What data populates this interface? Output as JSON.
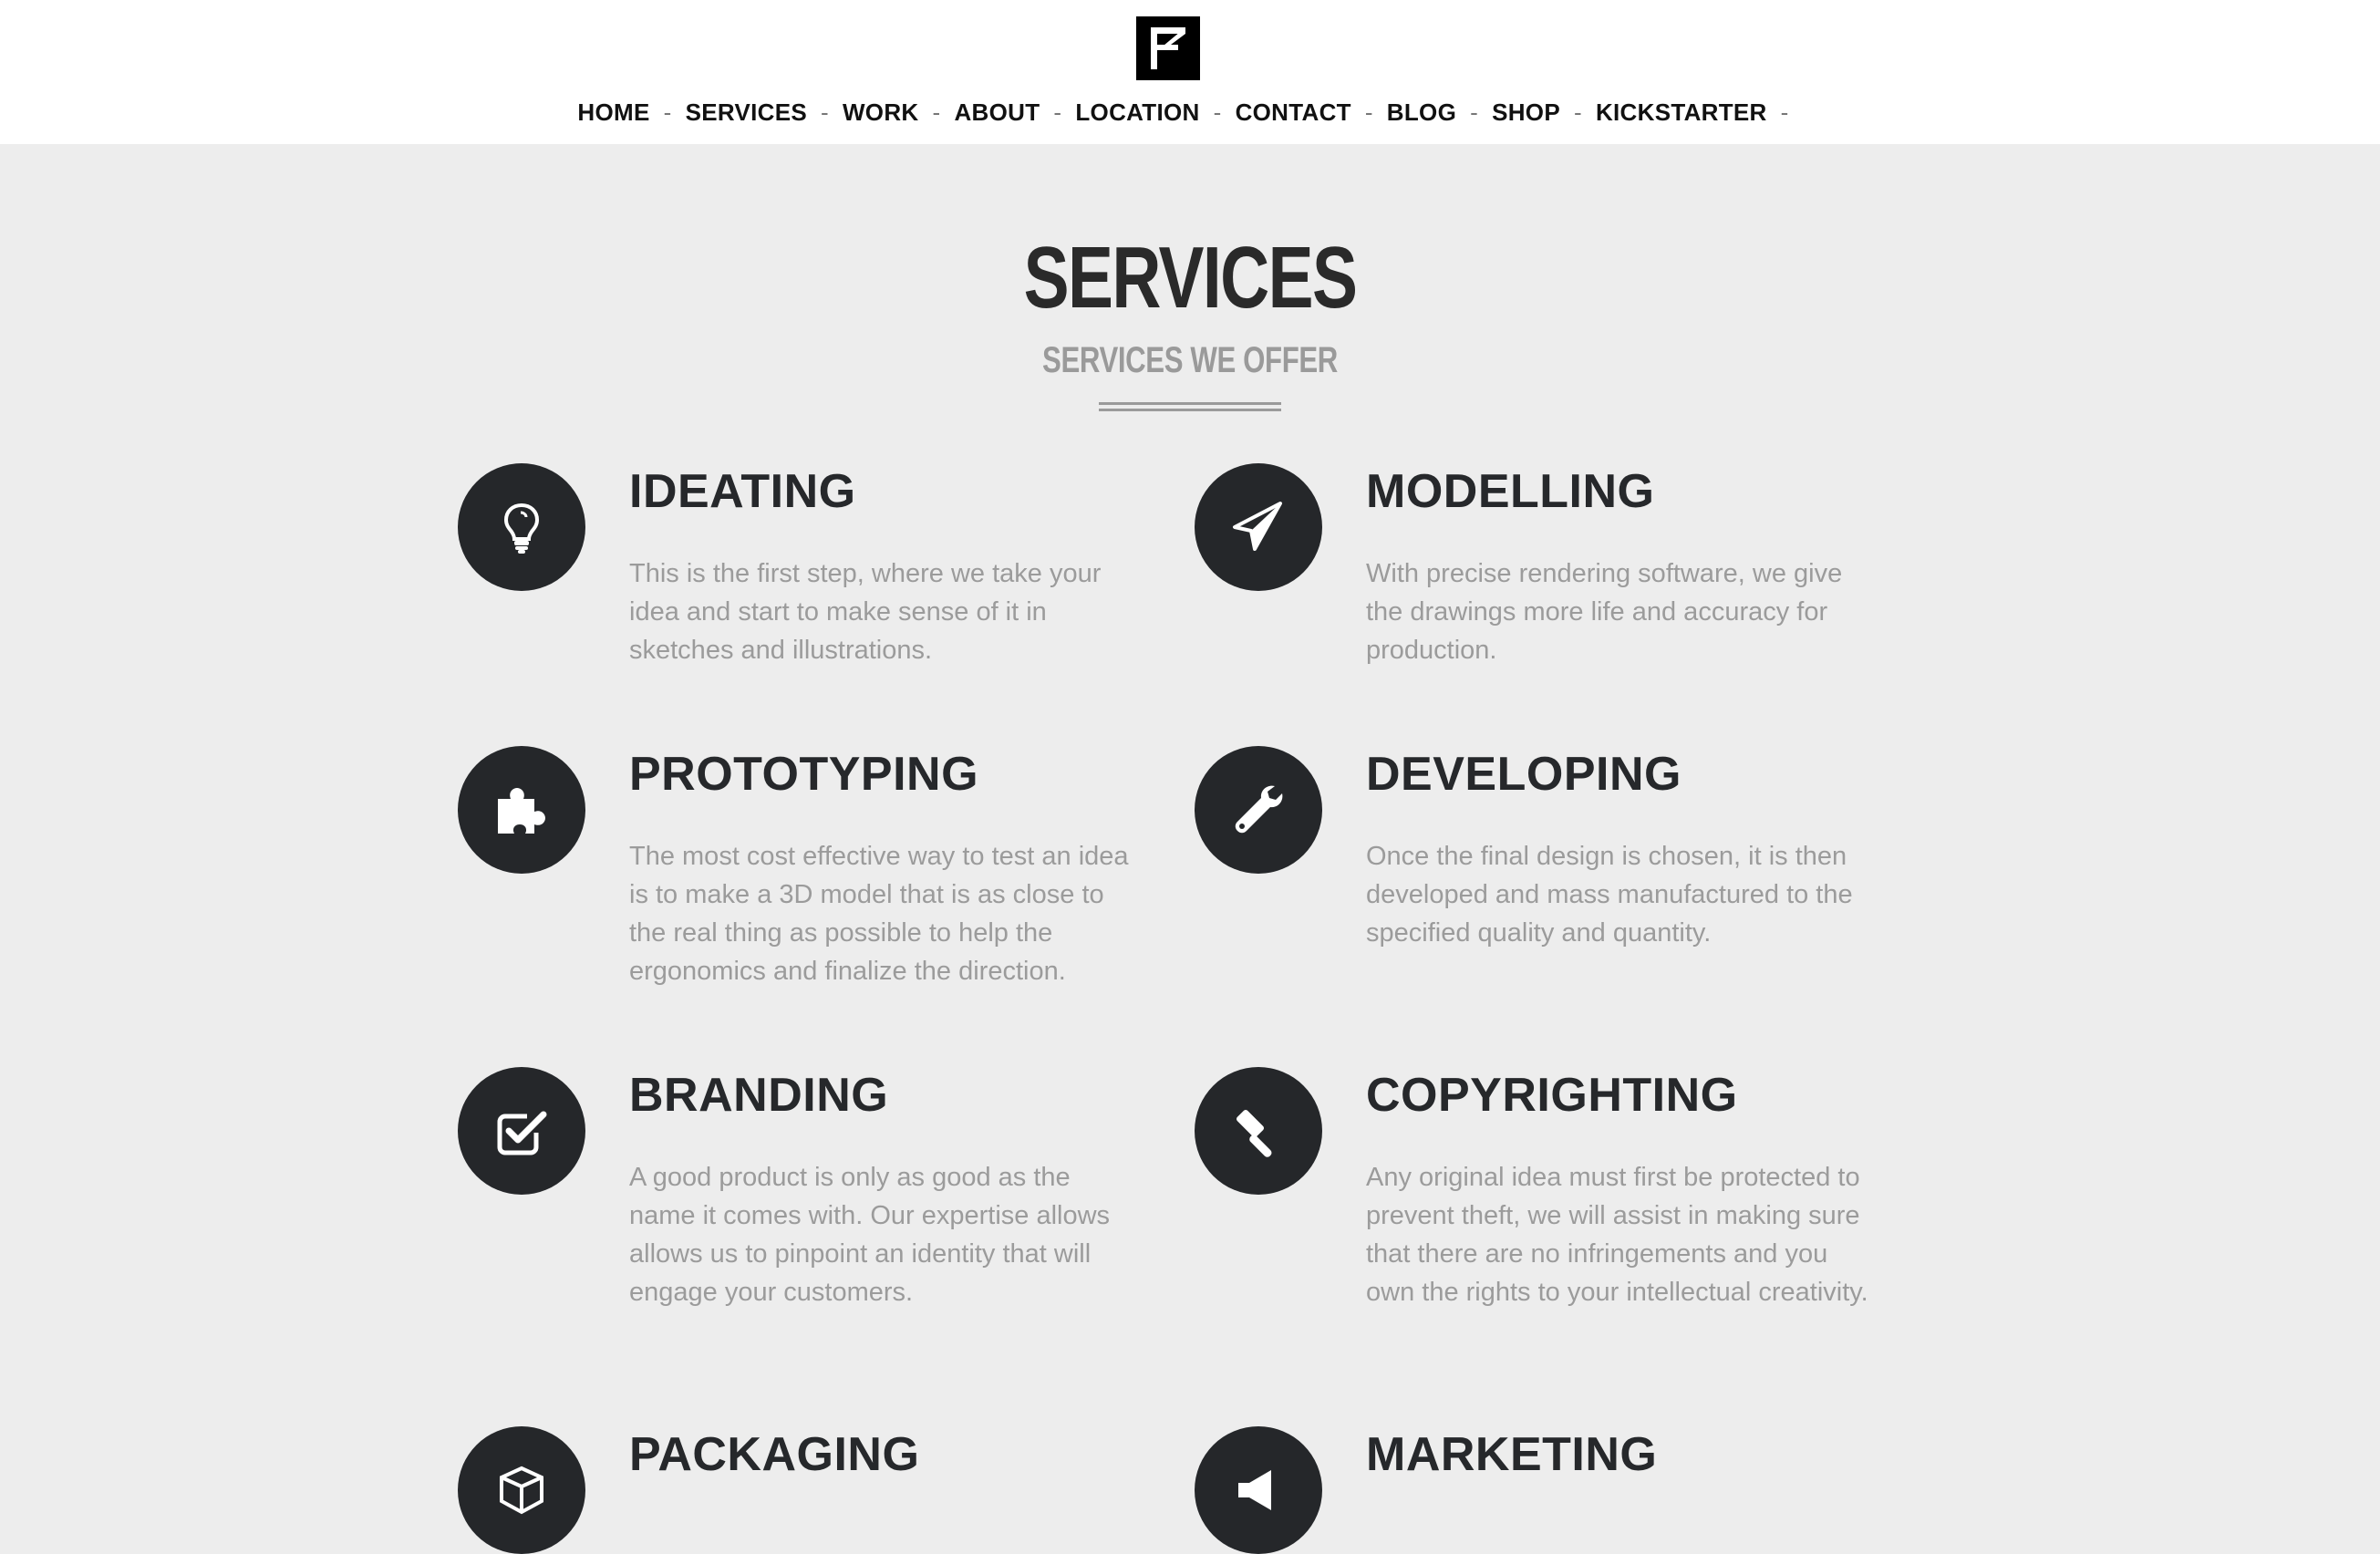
{
  "nav": {
    "items": [
      "HOME",
      "SERVICES",
      "WORK",
      "ABOUT",
      "LOCATION",
      "CONTACT",
      "BLOG",
      "SHOP",
      "KICKSTARTER"
    ],
    "separator": "-"
  },
  "header": {
    "title": "SERVICES",
    "subtitle": "SERVICES WE OFFER"
  },
  "services": [
    {
      "title": "IDEATING",
      "icon": "lightbulb-icon",
      "text": "This is the first step, where we take your idea and start to make sense of it in sketches and illustrations."
    },
    {
      "title": "MODELLING",
      "icon": "paper-plane-icon",
      "text": "With precise rendering software, we give the drawings more life and accuracy for production."
    },
    {
      "title": "PROTOTYPING",
      "icon": "puzzle-icon",
      "text": "The most cost effective way to test an idea is to make a 3D model that is as close to the real thing as possible to help the ergonomics and finalize the direction."
    },
    {
      "title": "DEVELOPING",
      "icon": "wrench-icon",
      "text": "Once the final design is chosen, it is then developed and mass manufactured to the specified quality and quantity."
    },
    {
      "title": "BRANDING",
      "icon": "checkbox-icon",
      "text": "A good product is only as good as the name it comes with. Our expertise allows allows us to pinpoint an identity that will engage your customers."
    },
    {
      "title": "COPYRIGHTING",
      "icon": "gavel-icon",
      "text": "Any original idea must first be protected to prevent theft, we will assist in making sure that there are no infringements and you own the rights to your intellectual creativity."
    },
    {
      "title": "PACKAGING",
      "icon": "box-icon",
      "text": ""
    },
    {
      "title": "MARKETING",
      "icon": "megaphone-icon",
      "text": ""
    }
  ],
  "colors": {
    "accent": "#25272a",
    "background": "#ededed",
    "muted_text": "#9b9b9b"
  }
}
